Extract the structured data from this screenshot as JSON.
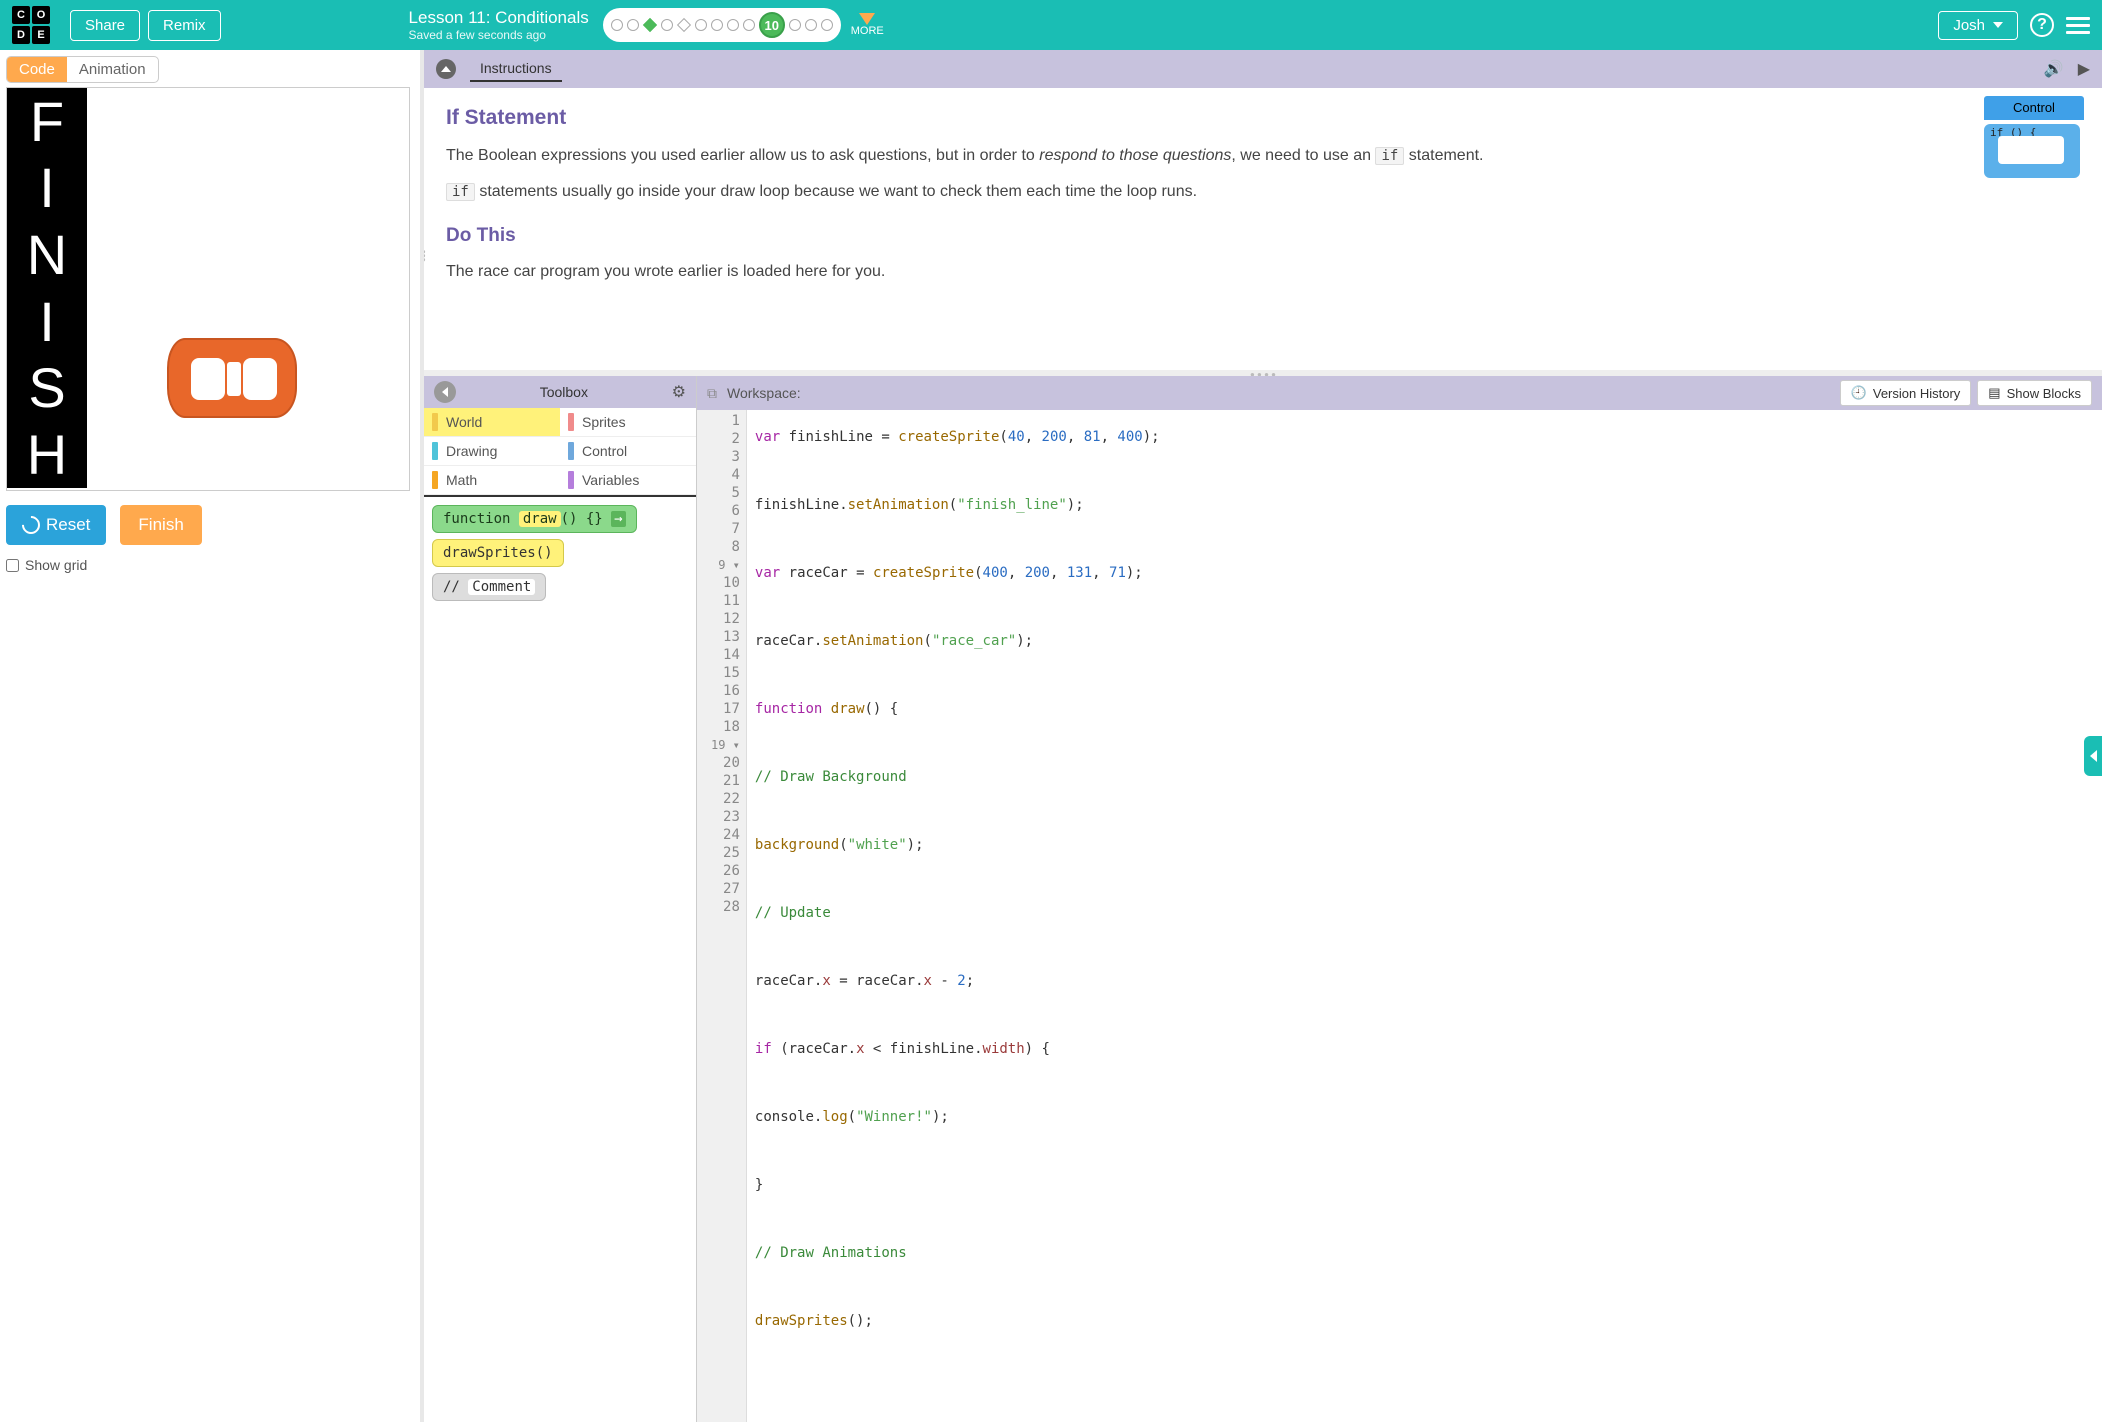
{
  "header": {
    "logo_letters": [
      "C",
      "O",
      "D",
      "E"
    ],
    "share": "Share",
    "remix": "Remix",
    "lesson_title": "Lesson 11: Conditionals",
    "saved": "Saved a few seconds ago",
    "current_level": "10",
    "more": "MORE",
    "user": "Josh",
    "help": "?"
  },
  "left": {
    "tab_code": "Code",
    "tab_anim": "Animation",
    "finish_letters": [
      "F",
      "I",
      "N",
      "I",
      "S",
      "H"
    ],
    "reset": "Reset",
    "finish": "Finish",
    "show_grid": "Show grid"
  },
  "instructions": {
    "tab": "Instructions",
    "h1": "If Statement",
    "p1a": "The Boolean expressions you used earlier allow us to ask questions, but in order to ",
    "p1b": "respond to those questions",
    "p1c": ", we need to use an ",
    "p1_code": "if",
    "p1d": " statement.",
    "p2_code": "if",
    "p2": " statements usually go inside your draw loop because we want to check them each time the loop runs.",
    "h2": "Do This",
    "p3": "The race car program you wrote earlier is loaded here for you.",
    "widget_label": "Control",
    "widget_text": "if () {"
  },
  "toolbox": {
    "title": "Toolbox",
    "cats": [
      {
        "label": "World",
        "color": "#f2c94c",
        "active": true
      },
      {
        "label": "Sprites",
        "color": "#f08b8b"
      },
      {
        "label": "Drawing",
        "color": "#4fc3d9"
      },
      {
        "label": "Control",
        "color": "#6fa8dc"
      },
      {
        "label": "Math",
        "color": "#f5a623"
      },
      {
        "label": "Variables",
        "color": "#b57edc"
      }
    ],
    "block_draw_a": "function ",
    "block_draw_b": "draw",
    "block_draw_c": "() {}",
    "block_sprites": "drawSprites()",
    "block_comment_a": "// ",
    "block_comment_b": "Comment"
  },
  "workspace": {
    "title": "Workspace:",
    "version": "Version History",
    "showblocks": "Show Blocks",
    "lines": 28
  },
  "code": {
    "l1": {
      "kw": "var",
      "sp": " ",
      "id": "finishLine",
      "eq": " = ",
      "fn": "createSprite",
      "op": "(",
      "a": "40",
      "c1": ", ",
      "b": "200",
      "c2": ", ",
      "c": "81",
      "c3": ", ",
      "d": "400",
      "cl": ");"
    },
    "l3": {
      "id": "finishLine.",
      "fn": "setAnimation",
      "op": "(",
      "s": "\"finish_line\"",
      "cl": ");"
    },
    "l5": {
      "kw": "var",
      "sp": " ",
      "id": "raceCar",
      "eq": " = ",
      "fn": "createSprite",
      "op": "(",
      "a": "400",
      "c1": ", ",
      "b": "200",
      "c2": ", ",
      "c": "131",
      "c3": ", ",
      "d": "71",
      "cl": ");"
    },
    "l7": {
      "id": "raceCar.",
      "fn": "setAnimation",
      "op": "(",
      "s": "\"race_car\"",
      "cl": ");"
    },
    "l9": {
      "kw": "function",
      "sp": " ",
      "fn": "draw",
      "rest": "() {"
    },
    "l11": "// Draw Background",
    "l13": {
      "fn": "background",
      "op": "(",
      "s": "\"white\"",
      "cl": ");"
    },
    "l15": "// Update",
    "l17": {
      "a": "raceCar.",
      "p": "x",
      "eq": " = ",
      "b": "raceCar.",
      "p2": "x",
      "op": " - ",
      "n": "2",
      "cl": ";"
    },
    "l19": {
      "kw": "if",
      "sp": " (raceCar.",
      "p": "x",
      "op": " < finishLine.",
      "p2": "width",
      "cl": ") {"
    },
    "l21": {
      "a": "console.",
      "fn": "log",
      "op": "(",
      "s": "\"Winner!\"",
      "cl": ");"
    },
    "l23": "}",
    "l25": "// Draw Animations",
    "l27": {
      "fn": "drawSprites",
      "rest": "();"
    }
  }
}
